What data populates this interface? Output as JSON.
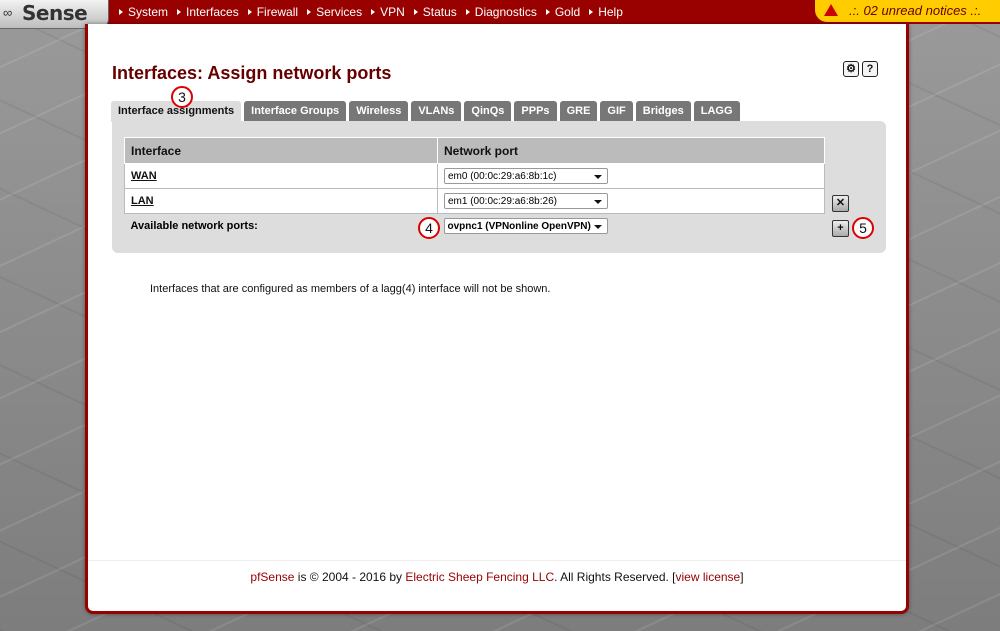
{
  "brand": {
    "logo_text": "Sense",
    "logo_mark": "∞"
  },
  "nav": [
    {
      "label": "System"
    },
    {
      "label": "Interfaces"
    },
    {
      "label": "Firewall"
    },
    {
      "label": "Services"
    },
    {
      "label": "VPN"
    },
    {
      "label": "Status"
    },
    {
      "label": "Diagnostics"
    },
    {
      "label": "Gold"
    },
    {
      "label": "Help"
    }
  ],
  "notice": {
    "text": ".:. 02 unread notices .:."
  },
  "page": {
    "title": "Interfaces: Assign network ports"
  },
  "tabs": [
    {
      "label": "Interface assignments",
      "active": true
    },
    {
      "label": "Interface Groups"
    },
    {
      "label": "Wireless"
    },
    {
      "label": "VLANs"
    },
    {
      "label": "QinQs"
    },
    {
      "label": "PPPs"
    },
    {
      "label": "GRE"
    },
    {
      "label": "GIF"
    },
    {
      "label": "Bridges"
    },
    {
      "label": "LAGG"
    }
  ],
  "table": {
    "headers": {
      "interface": "Interface",
      "network_port": "Network port"
    },
    "rows": [
      {
        "interface": "WAN",
        "port": "em0 (00:0c:29:a6:8b:1c)"
      },
      {
        "interface": "LAN",
        "port": "em1 (00:0c:29:a6:8b:26)"
      }
    ],
    "available": {
      "label": "Available network ports:",
      "port": "ovpnc1 (VPNonline OpenVPN)"
    }
  },
  "markers": {
    "m3": "3",
    "m4": "4",
    "m5": "5"
  },
  "info_text": "Interfaces that are configured as members of a lagg(4) interface will not be shown.",
  "footer": {
    "brand": "pfSense",
    "copyright": " is © 2004 - 2016 by ",
    "company": "Electric Sheep Fencing LLC",
    "rights": ". All Rights Reserved. [",
    "license_link": "view license",
    "close": "]"
  },
  "colors": {
    "brand_red": "#990000",
    "notice_yellow": "#ffcc00",
    "panel_grey": "#dddddd"
  }
}
